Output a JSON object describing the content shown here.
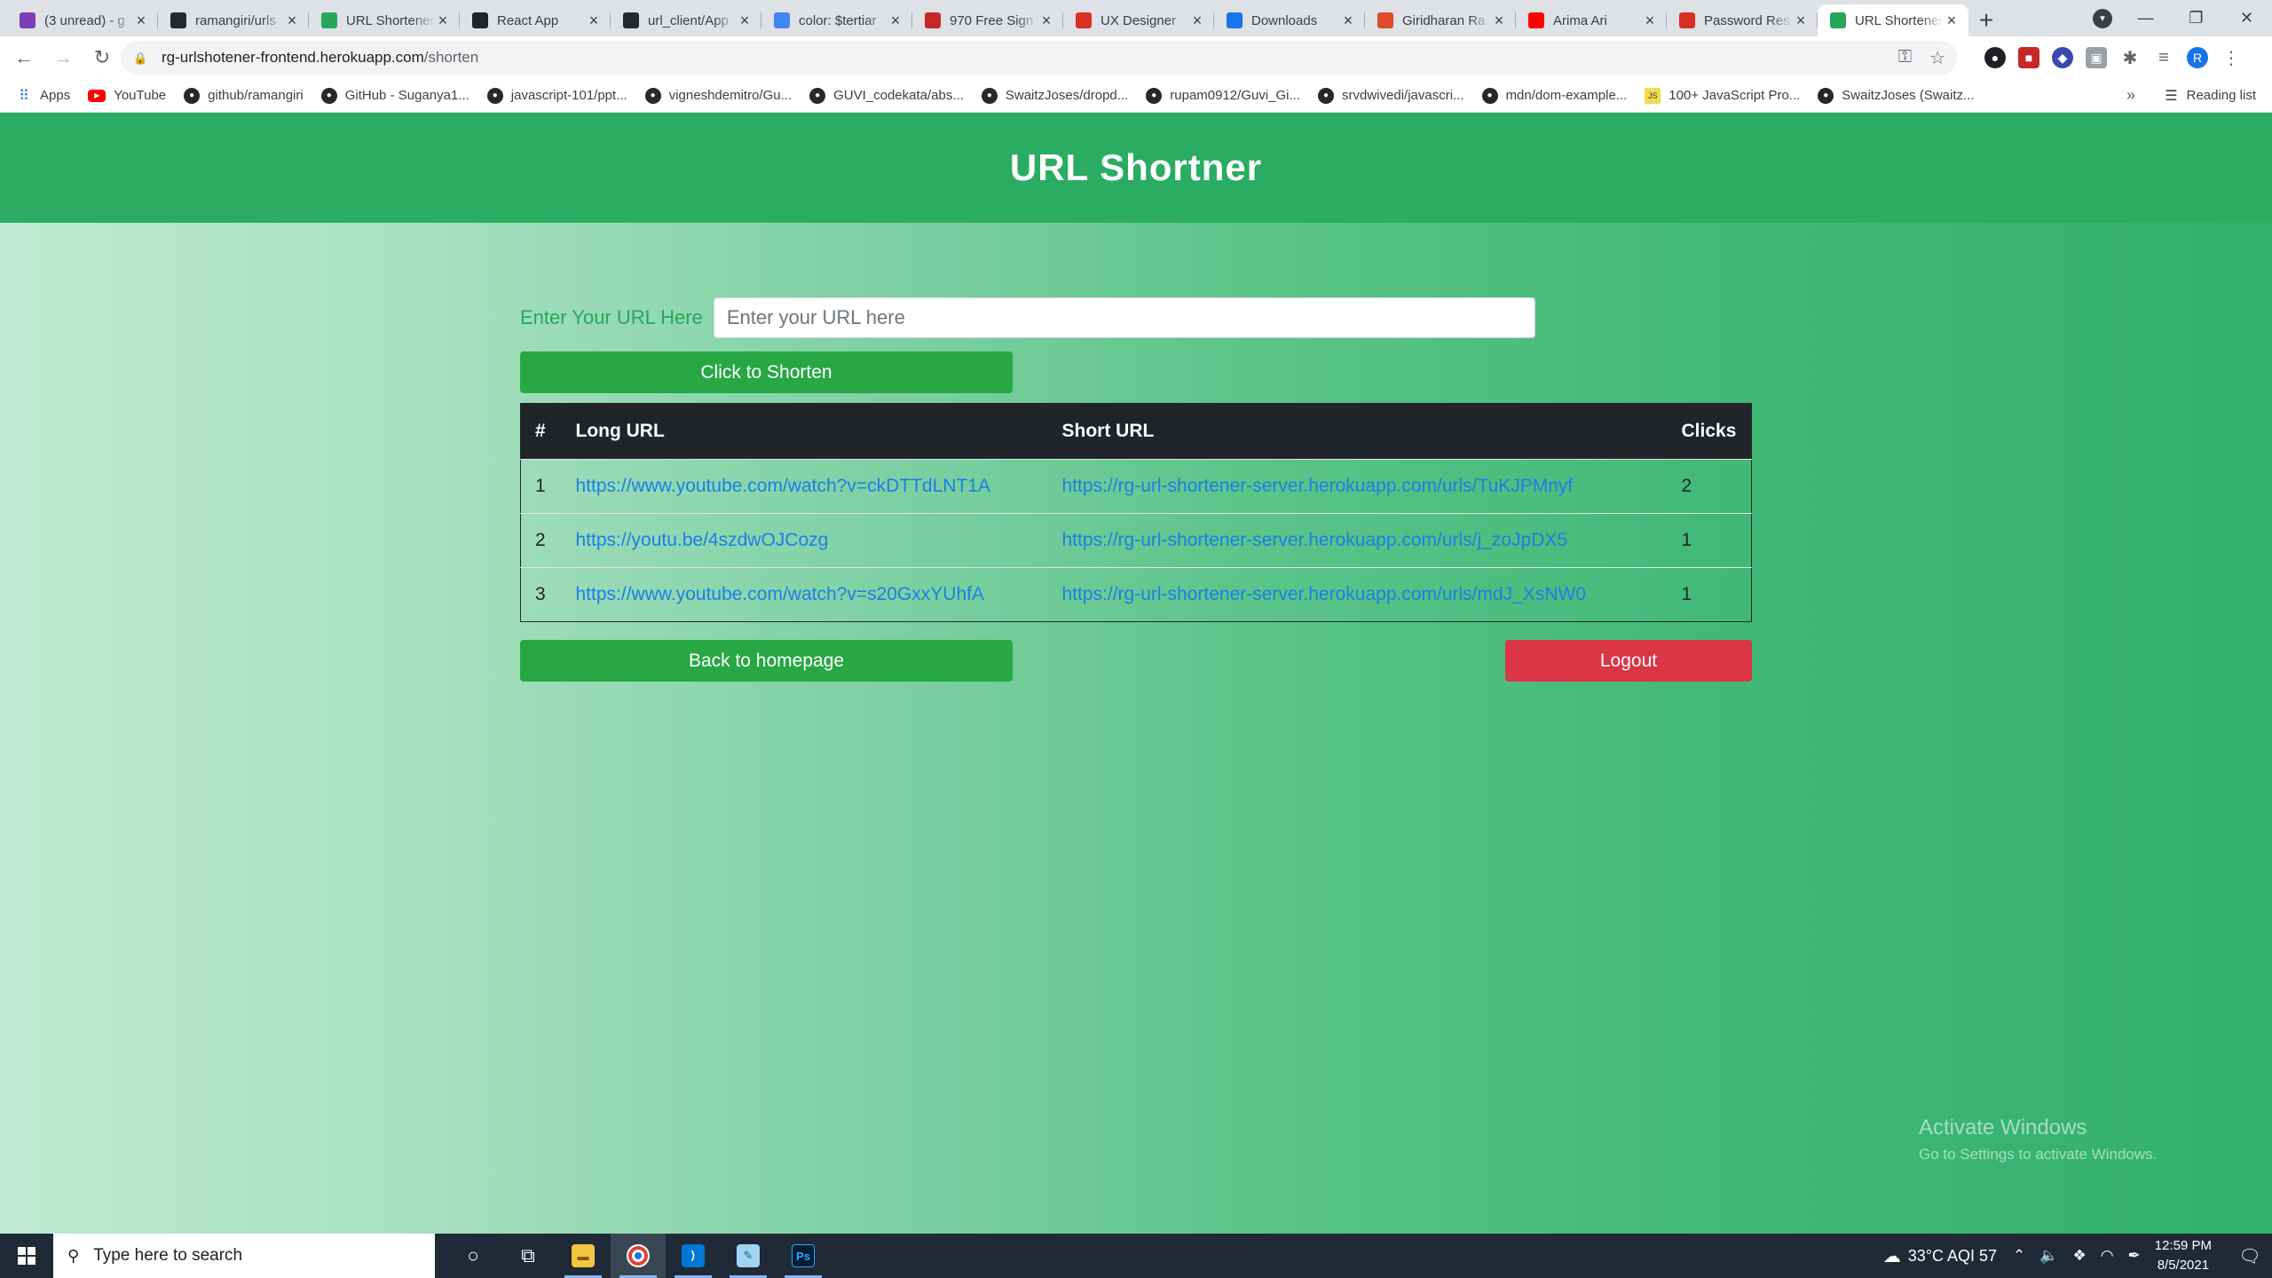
{
  "browser": {
    "tabs": [
      {
        "title": "(3 unread) - g",
        "icon": "gmail-icon",
        "color": "#7b3fb5"
      },
      {
        "title": "ramangiri/urls",
        "icon": "github-icon",
        "color": "#24292e"
      },
      {
        "title": "URL Shortener",
        "icon": "url-shortener-icon",
        "color": "#26a65b"
      },
      {
        "title": "React App",
        "icon": "react-icon",
        "color": "#20232a"
      },
      {
        "title": "url_client/App",
        "icon": "github-icon",
        "color": "#24292e"
      },
      {
        "title": "color: $tertiar",
        "icon": "google-icon",
        "color": "#4285f4"
      },
      {
        "title": "970 Free Sign",
        "icon": "flaticon-icon",
        "color": "#c62828"
      },
      {
        "title": "UX Designer",
        "icon": "gmail-icon",
        "color": "#d93025"
      },
      {
        "title": "Downloads",
        "icon": "download-icon",
        "color": "#1a73e8"
      },
      {
        "title": "Giridharan Ra",
        "icon": "figma-icon",
        "color": "#e04b2b"
      },
      {
        "title": "Arima Ari",
        "icon": "youtube-icon",
        "color": "#ff0000"
      },
      {
        "title": "Password Res",
        "icon": "gmail-icon",
        "color": "#d93025"
      },
      {
        "title": "URL Shortener",
        "icon": "url-shortener-icon",
        "color": "#26a65b"
      }
    ],
    "url_host": "rg-urlshotener-frontend.herokuapp.com",
    "url_path": "/shorten",
    "bookmarks": [
      {
        "label": "Apps",
        "icon": "apps-grid-icon"
      },
      {
        "label": "YouTube",
        "icon": "youtube-icon"
      },
      {
        "label": "github/ramangiri",
        "icon": "github-icon"
      },
      {
        "label": "GitHub - Suganya1...",
        "icon": "github-icon"
      },
      {
        "label": "javascript-101/ppt...",
        "icon": "github-icon"
      },
      {
        "label": "vigneshdemitro/Gu...",
        "icon": "github-icon"
      },
      {
        "label": "GUVI_codekata/abs...",
        "icon": "github-icon"
      },
      {
        "label": "SwaitzJoses/dropd...",
        "icon": "github-icon"
      },
      {
        "label": "rupam0912/Guvi_Gi...",
        "icon": "github-icon"
      },
      {
        "label": "srvdwivedi/javascri...",
        "icon": "github-icon"
      },
      {
        "label": "mdn/dom-example...",
        "icon": "github-icon"
      },
      {
        "label": "100+ JavaScript Pro...",
        "icon": "javascript-icon"
      },
      {
        "label": "SwaitzJoses (Swaitz...",
        "icon": "github-icon"
      }
    ],
    "more_symbol": "»",
    "reading_list": "Reading list"
  },
  "app": {
    "title": "URL Shortner",
    "input_label": "Enter Your URL Here",
    "input_placeholder": "Enter your URL here",
    "shorten_label": "Click to Shorten",
    "back_label": "Back to homepage",
    "logout_label": "Logout",
    "table": {
      "headers": [
        "#",
        "Long URL",
        "Short URL",
        "Clicks"
      ],
      "rows": [
        {
          "idx": "1",
          "long": "https://www.youtube.com/watch?v=ckDTTdLNT1A",
          "short": "https://rg-url-shortener-server.herokuapp.com/urls/TuKJPMnyf",
          "clicks": "2"
        },
        {
          "idx": "2",
          "long": "https://youtu.be/4szdwOJCozg",
          "short": "https://rg-url-shortener-server.herokuapp.com/urls/j_zoJpDX5",
          "clicks": "1"
        },
        {
          "idx": "3",
          "long": "https://www.youtube.com/watch?v=s20GxxYUhfA",
          "short": "https://rg-url-shortener-server.herokuapp.com/urls/mdJ_XsNW0",
          "clicks": "1"
        }
      ]
    },
    "colors": {
      "header_green": "#2aad62",
      "button_green": "#28a745",
      "logout_red": "#dc3545",
      "link_blue": "#1a7fe8"
    }
  },
  "watermark": {
    "line1": "Activate Windows",
    "line2": "Go to Settings to activate Windows."
  },
  "taskbar": {
    "search_placeholder": "Type here to search",
    "weather": "33°C  AQI 57",
    "time": "12:59 PM",
    "date": "8/5/2021"
  }
}
